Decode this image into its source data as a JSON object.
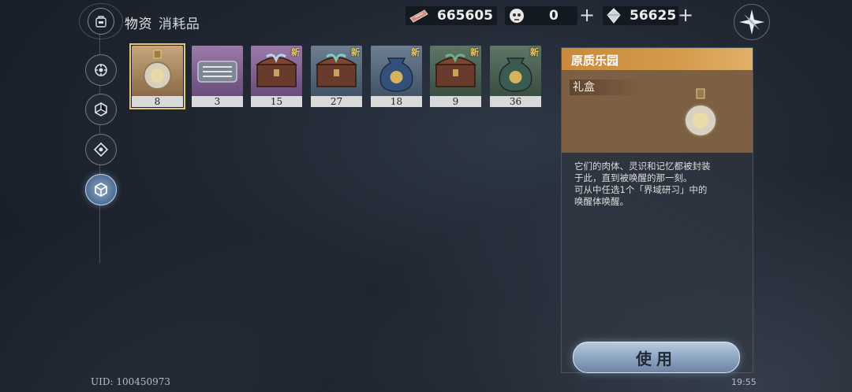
{
  "header": {
    "title": "物资",
    "subtitle": "消耗品"
  },
  "currencies": [
    {
      "name": "ticket-currency",
      "value": "665605"
    },
    {
      "name": "spirit-currency",
      "value": "0"
    },
    {
      "name": "crystal-currency",
      "value": "56625"
    }
  ],
  "items": [
    {
      "qty": "8",
      "new": "",
      "rarity": "gold",
      "icon": "flask-icon"
    },
    {
      "qty": "3",
      "new": "",
      "rarity": "purple",
      "icon": "tools-case-icon"
    },
    {
      "qty": "15",
      "new": "新",
      "rarity": "purple",
      "icon": "treasure-chest-icon"
    },
    {
      "qty": "27",
      "new": "新",
      "rarity": "blue",
      "icon": "treasure-chest-icon"
    },
    {
      "qty": "18",
      "new": "新",
      "rarity": "blue",
      "icon": "pouch-icon"
    },
    {
      "qty": "9",
      "new": "新",
      "rarity": "green",
      "icon": "treasure-chest-icon"
    },
    {
      "qty": "36",
      "new": "新",
      "rarity": "green",
      "icon": "pouch-icon"
    }
  ],
  "detail": {
    "name": "原质乐园",
    "type": "礼盒",
    "description_lines": [
      "它们的肉体、灵识和记忆都被封装",
      "于此，直到被唤醒的那一刻。",
      "可从中任选1个「界域研习」中的",
      "唤醒体唤醒。"
    ],
    "use_label": "使用"
  },
  "footer": {
    "uid": "UID: 100450973",
    "time": "19:55"
  },
  "colors": {
    "accent_gold": "#e6c57a",
    "header_orange": "#d59a4c",
    "new_badge": "#f3cf6b"
  }
}
